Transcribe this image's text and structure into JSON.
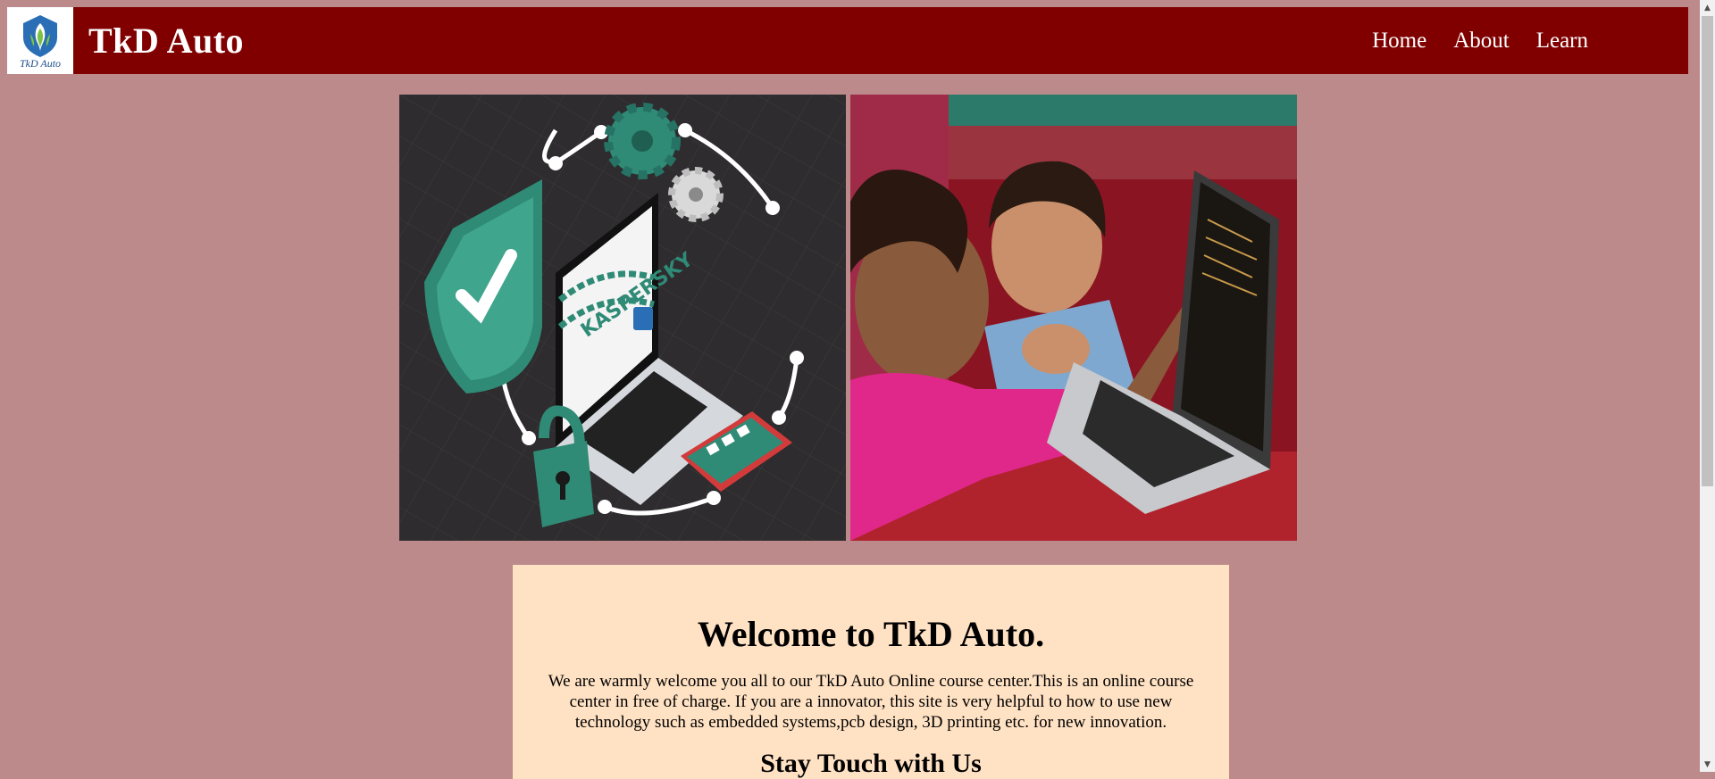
{
  "header": {
    "logo_caption": "TkD Auto",
    "brand": "TkD Auto",
    "nav": [
      "Home",
      "About",
      "Learn"
    ]
  },
  "hero": {
    "left_image": {
      "icon": "cybersecurity-laptop-illustration",
      "caption": "KASPERSKY"
    },
    "right_image": {
      "icon": "children-with-laptop-photo"
    }
  },
  "welcome": {
    "title": "Welcome to TkD Auto.",
    "body": "We are warmly welcome you all to our TkD Auto Online course center.This is an online course center in free of charge. If you are a innovator, this site is very helpful to how to use new technology such as embedded systems,pcb design, 3D printing etc. for new innovation.",
    "subtitle": "Stay Touch with Us"
  },
  "colors": {
    "page_bg": "#bc8a8a",
    "navbar_bg": "#800000",
    "welcome_bg": "#ffe1c3"
  }
}
